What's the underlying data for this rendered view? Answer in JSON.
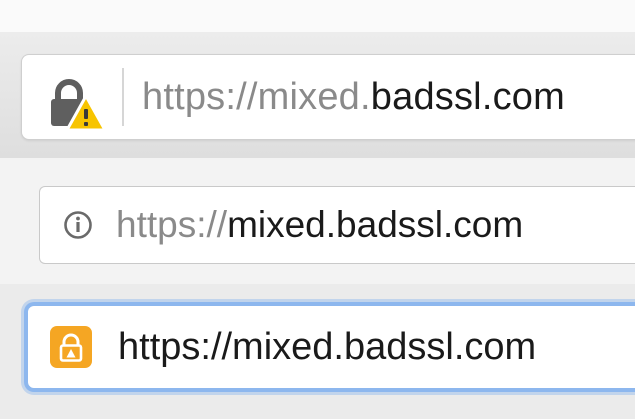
{
  "colors": {
    "warning_yellow": "#f7c400",
    "lock_gray": "#5f5f5f",
    "info_gray": "#6a6a6a",
    "safari_lock_orange": "#f5a623",
    "focus_blue": "#8db7ee",
    "url_dim": "#8a8a8a",
    "url_dark": "#1a1a1a"
  },
  "bars": [
    {
      "browser": "firefox",
      "icon": "lock-warning-icon",
      "url_scheme": "https://",
      "url_subdomain": "mixed.",
      "url_domain": "badssl.com"
    },
    {
      "browser": "chrome",
      "icon": "info-circle-icon",
      "url_scheme": "https://",
      "url_host": "mixed.badssl.com"
    },
    {
      "browser": "safari",
      "icon": "lock-warning-badge-icon",
      "url_full": "https://mixed.badssl.com"
    }
  ]
}
